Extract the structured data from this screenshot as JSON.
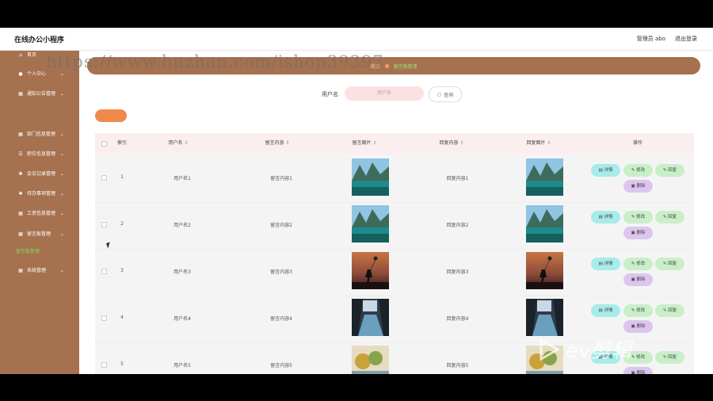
{
  "topbar": {
    "title": "在线办公小程序",
    "admin": "管理员 abo",
    "logout": "退出登录"
  },
  "sidebar": {
    "items": [
      {
        "label": "首页",
        "icon": "home-icon",
        "chev": ""
      },
      {
        "label": "个人中心",
        "icon": "user-icon",
        "chev": "⌄"
      },
      {
        "label": "通知公告管理",
        "icon": "grid-icon",
        "chev": "⌄"
      },
      {
        "label": "部门信息管理",
        "icon": "grid-icon",
        "chev": "⌄"
      },
      {
        "label": "职位信息管理",
        "icon": "list-icon",
        "chev": "⌄"
      },
      {
        "label": "会议记录管理",
        "icon": "gear-icon",
        "chev": "⌄"
      },
      {
        "label": "待办事项管理",
        "icon": "gear-icon",
        "chev": "⌄"
      },
      {
        "label": "工资信息管理",
        "icon": "grid-icon",
        "chev": "⌄"
      },
      {
        "label": "留言板管理",
        "icon": "grid-icon",
        "chev": "⌄"
      },
      {
        "label": "留言板管理",
        "icon": "",
        "chev": ""
      },
      {
        "label": "系统管理",
        "icon": "grid-icon",
        "chev": "⌄"
      }
    ]
  },
  "breadcrumb": {
    "home": "首页",
    "current": "留言板管理"
  },
  "search": {
    "label": "用户名",
    "placeholder": "用户名",
    "button": "查询"
  },
  "watermark": "https://www.huzhan.com/ishop39397",
  "table": {
    "headers": {
      "index": "索引",
      "username": "用户名",
      "content": "留言内容",
      "image": "留言图片",
      "reply": "回复内容",
      "reply_image": "回复图片",
      "ops": "操作"
    },
    "rows": [
      {
        "index": "1",
        "username": "用户名1",
        "content": "留言内容1",
        "reply": "回复内容1",
        "img": "lake"
      },
      {
        "index": "2",
        "username": "用户名2",
        "content": "留言内容2",
        "reply": "回复内容2",
        "img": "lake"
      },
      {
        "index": "3",
        "username": "用户名3",
        "content": "留言内容3",
        "reply": "回复内容3",
        "img": "sunset"
      },
      {
        "index": "4",
        "username": "用户名4",
        "content": "留言内容4",
        "reply": "回复内容4",
        "img": "river"
      },
      {
        "index": "5",
        "username": "用户名5",
        "content": "留言内容5",
        "reply": "回复内容5",
        "img": "autumn"
      }
    ],
    "actions": {
      "detail": "详情",
      "edit": "修改",
      "reply": "回复",
      "delete": "删除"
    }
  },
  "logo": {
    "text": "ev剪辑"
  }
}
